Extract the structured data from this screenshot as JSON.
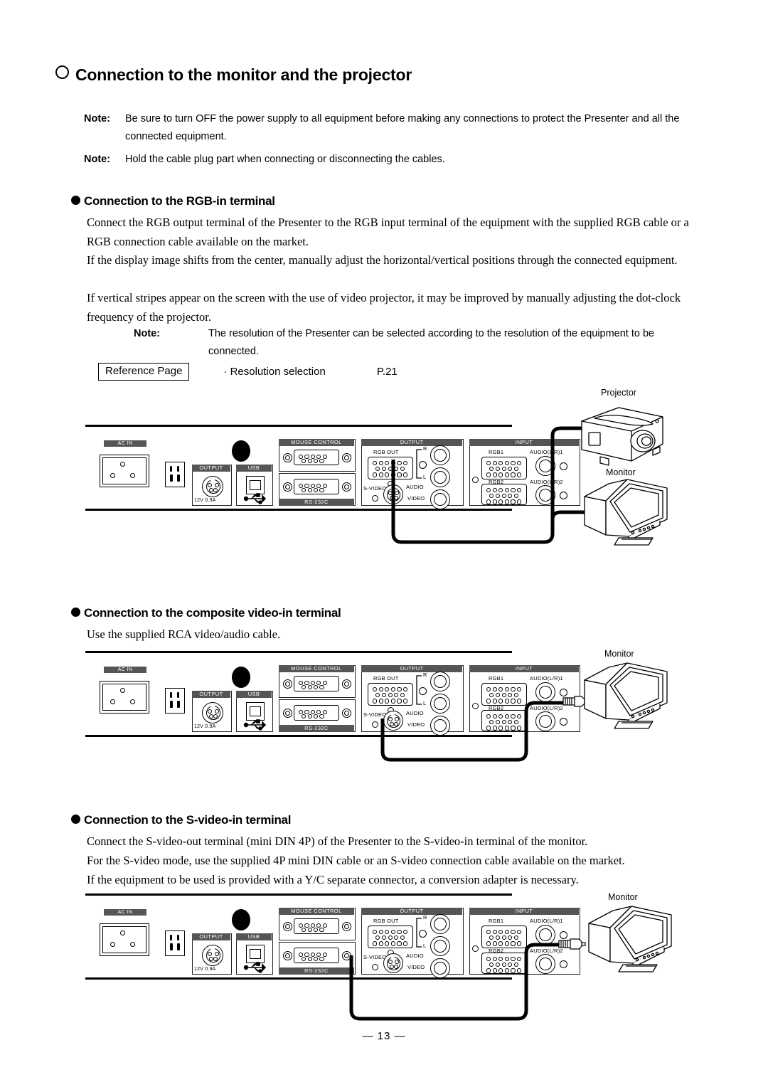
{
  "page": {
    "title": "Connection to the monitor and the projector",
    "number": "— 13 —"
  },
  "notes_top": [
    {
      "label": "Note:",
      "text": "Be sure to turn OFF the power supply to all equipment before making any connections to protect the Presenter and all the connected equipment."
    },
    {
      "label": "Note:",
      "text": "Hold the cable plug part when connecting or disconnecting the cables."
    }
  ],
  "sections": [
    {
      "heading": "Connection to the RGB-in terminal",
      "paragraphs": [
        "Connect the RGB output terminal of the Presenter to the RGB input terminal of the equipment with the supplied RGB cable or a RGB connection cable available on the market.",
        "If the display image shifts from the center, manually adjust the horizontal/vertical positions through the connected equipment.",
        "If vertical stripes appear on the screen with the use of video projector, it may be improved by manually adjusting the dot-clock frequency of the projector."
      ],
      "note": {
        "label": "Note:",
        "text": "The resolution of the Presenter can be selected according to the resolution of the equipment to be connected."
      },
      "reference": {
        "box_label": "Reference Page",
        "item": "· Resolution selection",
        "page": "P.21"
      },
      "devices": [
        {
          "name": "Projector"
        },
        {
          "name": "Monitor"
        }
      ]
    },
    {
      "heading": "Connection to the composite video-in terminal",
      "paragraphs": [
        "Use the supplied RCA video/audio cable."
      ],
      "devices": [
        {
          "name": "Monitor"
        }
      ]
    },
    {
      "heading": "Connection to the S-video-in terminal",
      "paragraphs": [
        "Connect the S-video-out terminal (mini DIN 4P) of the Presenter to the S-video-in terminal of the monitor.",
        "For the S-video mode, use the supplied 4P mini DIN cable or an S-video connection cable available on the market.",
        "If the equipment to be used is provided with a Y/C separate connector, a conversion adapter is necessary."
      ],
      "devices": [
        {
          "name": "Monitor"
        }
      ]
    }
  ],
  "panel": {
    "labels": {
      "ac_in": "AC IN",
      "dc_output": "OUTPUT",
      "dc_rating": "12V    0.9A",
      "usb": "USB",
      "mouse_control": "MOUSE CONTROL",
      "rs232c": "RS-232C",
      "output": "OUTPUT",
      "rgb_out": "RGB OUT",
      "s_video": "S-VIDEO",
      "audio": "AUDIO",
      "audio_r": "R",
      "audio_l": "L",
      "video": "VIDEO",
      "input": "INPUT",
      "rgb1": "RGB1",
      "rgb2": "RGB2",
      "audio_lr1": "AUDIO(L/R)1",
      "audio_lr2": "AUDIO(L/R)2"
    },
    "colors": {
      "label_bar_bg": "#555555",
      "label_bar_text": "#ffffff",
      "line": "#000000"
    }
  }
}
